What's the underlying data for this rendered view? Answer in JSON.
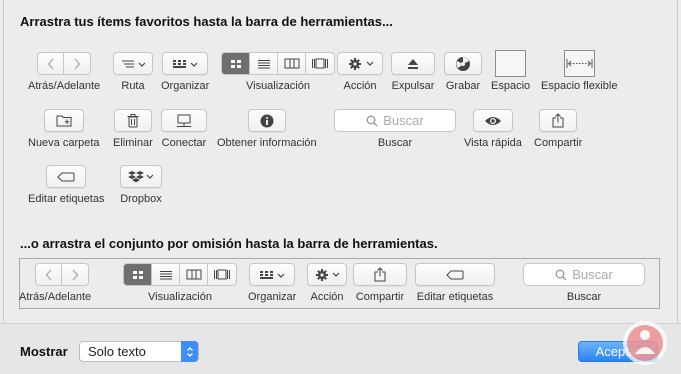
{
  "drag_items_heading": "Arrastra tus ítems favoritos hasta la barra de herramientas...",
  "default_set_heading": "...o arrastra el conjunto por omisión hasta la barra de herramientas.",
  "items": {
    "back_forward": "Atrás/Adelante",
    "path": "Ruta",
    "arrange": "Organizar",
    "view": "Visualización",
    "action": "Acción",
    "eject": "Expulsar",
    "burn": "Grabar",
    "space": "Espacio",
    "flexible_space": "Espacio flexible",
    "new_folder": "Nueva carpeta",
    "delete": "Eliminar",
    "connect": "Conectar",
    "get_info": "Obtener información",
    "search": "Buscar",
    "quick_look": "Vista rápida",
    "share": "Compartir",
    "edit_tags": "Editar etiquetas",
    "dropbox": "Dropbox"
  },
  "search_placeholder": "Buscar",
  "default_set": {
    "back_forward": "Atrás/Adelante",
    "view": "Visualización",
    "arrange": "Organizar",
    "action": "Acción",
    "share": "Compartir",
    "edit_tags": "Editar etiquetas",
    "search": "Buscar",
    "search_placeholder": "Buscar"
  },
  "footer": {
    "show_label": "Mostrar",
    "show_value": "Solo texto",
    "accept_label": "Aceptar"
  },
  "colors": {
    "accent": "#2a84f5",
    "selected_segment": "#6f6f6f",
    "window_bg": "#ececec"
  }
}
